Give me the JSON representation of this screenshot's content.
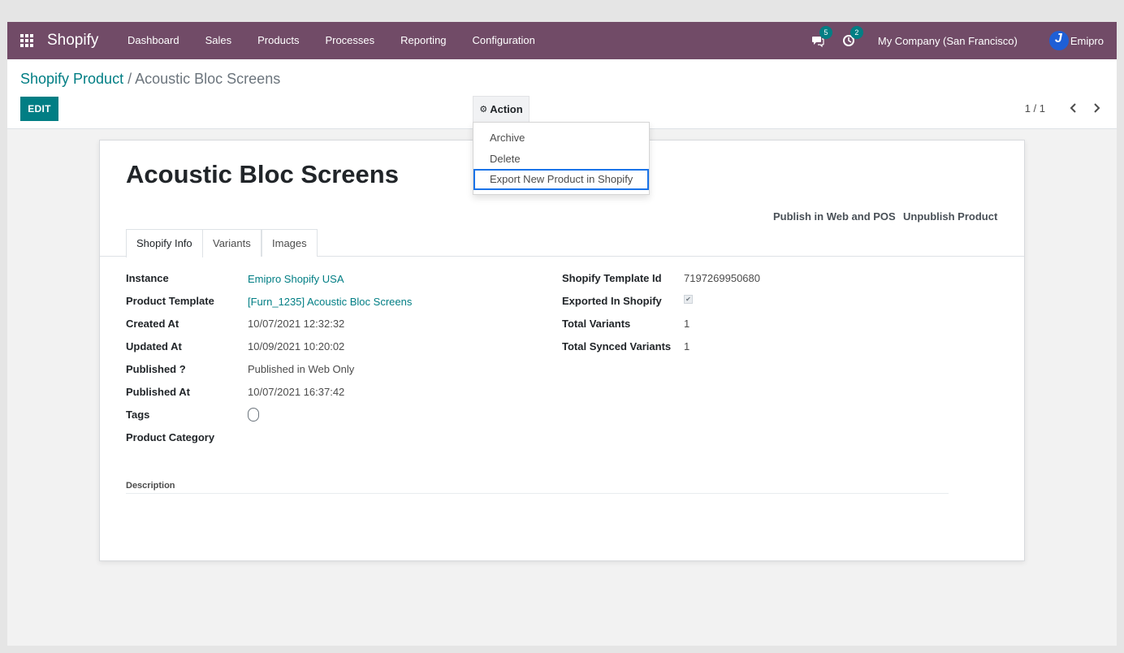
{
  "navbar": {
    "brand": "Shopify",
    "menu": [
      "Dashboard",
      "Sales",
      "Products",
      "Processes",
      "Reporting",
      "Configuration"
    ],
    "messages_count": "5",
    "activities_count": "2",
    "company": "My Company (San Francisco)",
    "user": "Emipro"
  },
  "breadcrumb": {
    "parent": "Shopify Product",
    "separator": "/",
    "current": "Acoustic Bloc Screens"
  },
  "buttons": {
    "edit": "EDIT",
    "action": "Action"
  },
  "pager": {
    "value": "1 / 1"
  },
  "action_menu": [
    "Archive",
    "Delete",
    "Export New Product in Shopify"
  ],
  "product": {
    "title": "Acoustic Bloc Screens",
    "header_buttons": [
      "Publish in Web and POS",
      "Unpublish Product"
    ],
    "tabs": [
      "Shopify Info",
      "Variants",
      "Images"
    ]
  },
  "fields_left": {
    "instance_label": "Instance",
    "instance_value": "Emipro Shopify USA",
    "template_label": "Product Template",
    "template_value": "[Furn_1235] Acoustic Bloc Screens",
    "created_label": "Created At",
    "created_value": "10/07/2021 12:32:32",
    "updated_label": "Updated At",
    "updated_value": "10/09/2021 10:20:02",
    "published_label": "Published ?",
    "published_value": "Published in Web Only",
    "published_at_label": "Published At",
    "published_at_value": "10/07/2021 16:37:42",
    "tags_label": "Tags",
    "category_label": "Product Category"
  },
  "fields_right": {
    "template_id_label": "Shopify Template Id",
    "template_id_value": "7197269950680",
    "exported_label": "Exported In Shopify",
    "exported_value": true,
    "total_variants_label": "Total Variants",
    "total_variants_value": "1",
    "synced_variants_label": "Total Synced Variants",
    "synced_variants_value": "1"
  },
  "description_label": "Description",
  "colors": {
    "navbar": "#714b67",
    "primary": "#017e84",
    "highlight_outline": "#1a73e8"
  }
}
